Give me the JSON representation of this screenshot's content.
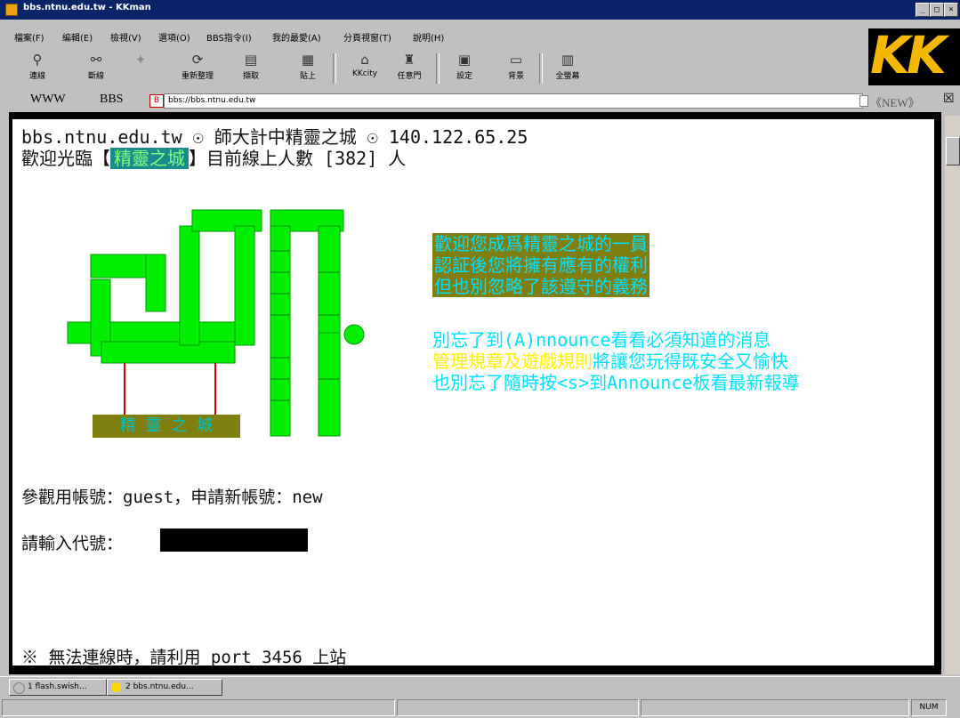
{
  "window": {
    "title": "bbs.ntnu.edu.tw - KKman"
  },
  "menu": [
    "檔案(F)",
    "編輯(E)",
    "檢視(V)",
    "選項(O)",
    "BBS指令(I)",
    "我的最愛(A)",
    "分頁視窗(T)",
    "說明(H)"
  ],
  "toolbar": [
    {
      "label": "連線",
      "icon": "plug-icon"
    },
    {
      "label": "斷線",
      "icon": "disconnect-icon"
    },
    {
      "label": "",
      "icon": "faded-icon"
    },
    {
      "label": "重新整理",
      "icon": "refresh-icon"
    },
    {
      "label": "擷取",
      "icon": "capture-icon"
    },
    {
      "label": "貼上",
      "icon": "paste-icon"
    },
    {
      "label": "KKcity",
      "icon": "home-icon"
    },
    {
      "label": "任意門",
      "icon": "door-icon"
    },
    {
      "label": "設定",
      "icon": "settings-icon"
    },
    {
      "label": "背景",
      "icon": "background-icon"
    },
    {
      "label": "全螢幕",
      "icon": "fullscreen-icon"
    }
  ],
  "brand": {
    "logo_text": "KK",
    "color": "#f5b800"
  },
  "address": {
    "www_label": "WWW",
    "bbs_label": "BBS",
    "url": "bbs://bbs.ntnu.edu.tw",
    "new_label": "《NEW》"
  },
  "terminal": {
    "header_line": "bbs.ntnu.edu.tw ☉ 師大計中精靈之城 ☉ 140.122.65.25",
    "welcome_prefix": "歡迎光臨【",
    "site_name": "精靈之城",
    "welcome_suffix": "】目前線上人數 [382] 人",
    "logo_caption": "精 靈 之 城",
    "notice_lines": [
      "歡迎您成爲精靈之城的一員",
      "認証後您將擁有應有的權利",
      "但也別忽略了該遵守的義務"
    ],
    "info_line1": "別忘了到(A)nnounce看看必須知道的消息",
    "info_line2_a": "管理規章及遊戲規則",
    "info_line2_b": "將讓您玩得既安全又愉快",
    "info_line3": "也別忘了隨時按<s>到Announce板看最新報導",
    "guest_line": "參觀用帳號：guest，申請新帳號：new",
    "login_prompt": "請輸入代號：",
    "login_value": "",
    "footer_line": "※ 無法連線時，請利用 port 3456 上站",
    "colors": {
      "logo_green": "#00ee00",
      "olive_bg": "#7f7f10",
      "cyan": "#00e0ff",
      "yellow": "#ffee00",
      "teal_bg": "#1a8b8b",
      "red": "#e00000"
    }
  },
  "taskbar": [
    "1 flash.swish...",
    "2 bbs.ntnu.edu..."
  ],
  "status": {
    "num": "NUM"
  }
}
